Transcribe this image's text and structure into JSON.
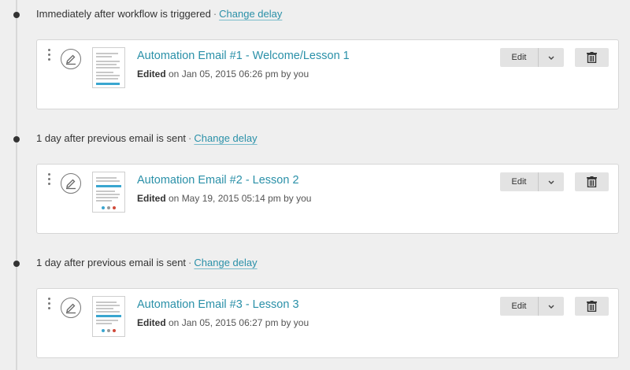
{
  "steps": [
    {
      "delay": {
        "text": "Immediately after workflow is triggered",
        "separator": "·",
        "link": "Change delay"
      },
      "email": {
        "title": "Automation Email #1 - Welcome/Lesson 1",
        "status": "Edited",
        "meta": " on Jan 05, 2015 06:26 pm by you",
        "edit_label": "Edit"
      }
    },
    {
      "delay": {
        "text": "1 day after previous email is sent",
        "separator": "·",
        "link": "Change delay"
      },
      "email": {
        "title": "Automation Email #2 - Lesson 2",
        "status": "Edited",
        "meta": " on May 19, 2015 05:14 pm by you",
        "edit_label": "Edit"
      }
    },
    {
      "delay": {
        "text": "1 day after previous email is sent",
        "separator": "·",
        "link": "Change delay"
      },
      "email": {
        "title": "Automation Email #3 - Lesson 3",
        "status": "Edited",
        "meta": " on Jan 05, 2015 06:27 pm by you",
        "edit_label": "Edit"
      }
    }
  ],
  "icons": {
    "drag": "drag-handle-icon",
    "edit": "pencil-icon",
    "caret": "chevron-down-icon",
    "delete": "trash-icon"
  },
  "colors": {
    "link": "#2a90a8",
    "background": "#efefef",
    "button": "#e3e3e3"
  }
}
